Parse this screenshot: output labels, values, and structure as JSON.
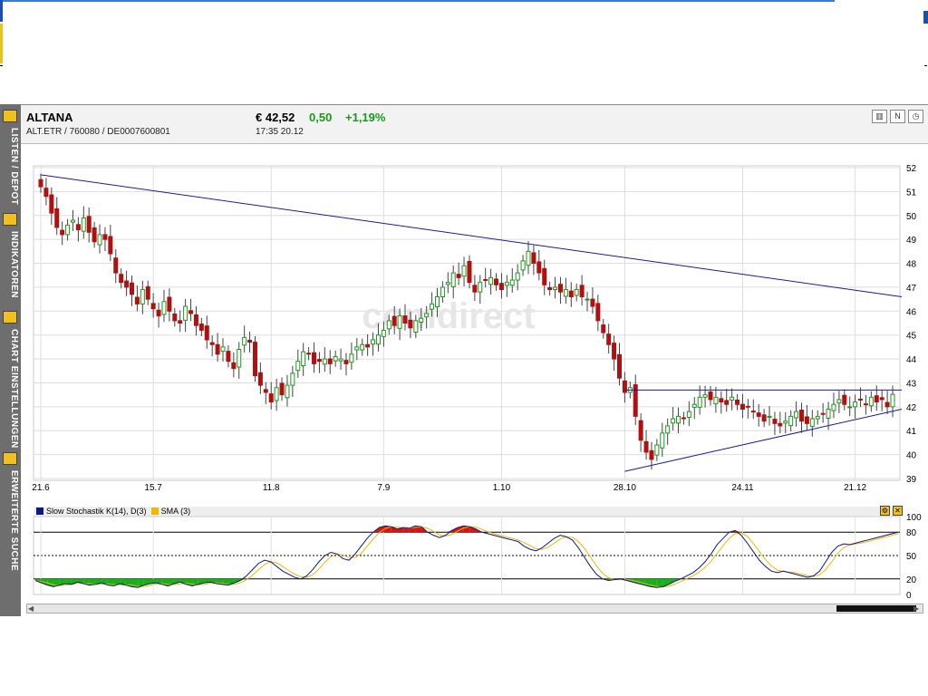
{
  "sidebar": {
    "items": [
      {
        "label": "LISTEN / DEPOT",
        "icon": "folder-icon"
      },
      {
        "label": "INDIKATOREN",
        "icon": "indicator-icon"
      },
      {
        "label": "CHART EINSTELLUNGEN",
        "icon": "settings-list-icon"
      },
      {
        "label": "ERWEITERTE SUCHE",
        "icon": "magnifier-icon"
      }
    ]
  },
  "header": {
    "name": "ALTANA",
    "codes": "ALT.ETR  /  760080  /  DE0007600801",
    "price": "€ 42,52",
    "change": "0,50",
    "change_pct": "+1,19%",
    "time": "17:35    20.12",
    "buttons": [
      "chart-type-icon",
      "news-icon",
      "clock-icon"
    ]
  },
  "watermark": "comdirect",
  "colors": {
    "up": "#1a9a1a",
    "down": "#b01010",
    "trendline": "#1a1aa0",
    "stoch_k": "#0a1a80",
    "stoch_d": "#f0b800",
    "fill_over": "#e01010",
    "fill_under": "#18b018"
  },
  "chart_data": [
    {
      "type": "candlestick",
      "title": "ALTANA",
      "x_tick_labels": [
        "21.6",
        "15.7",
        "11.8",
        "7.9",
        "1.10",
        "28.10",
        "24.11",
        "21.12"
      ],
      "y_ticks": [
        39,
        40,
        41,
        42,
        43,
        44,
        45,
        46,
        47,
        48,
        49,
        50,
        51,
        52
      ],
      "ylim": [
        39,
        52
      ],
      "grid": true,
      "close_series": [
        51.2,
        50.8,
        50.1,
        49.5,
        49.2,
        49.6,
        49.8,
        49.4,
        49.9,
        49.3,
        48.9,
        49.2,
        49.0,
        48.4,
        47.6,
        47.2,
        47.0,
        46.7,
        46.3,
        46.9,
        46.5,
        46.1,
        45.8,
        46.4,
        46.0,
        45.6,
        45.5,
        46.2,
        45.9,
        45.4,
        45.2,
        44.8,
        44.6,
        44.2,
        44.5,
        43.9,
        43.6,
        44.4,
        44.9,
        44.7,
        43.3,
        42.9,
        42.6,
        42.2,
        42.8,
        42.5,
        42.9,
        43.4,
        43.9,
        44.3,
        44.2,
        43.8,
        43.9,
        44.0,
        43.8,
        44.1,
        44.0,
        43.8,
        44.2,
        44.5,
        44.6,
        44.5,
        44.8,
        45.0,
        45.2,
        45.6,
        45.4,
        45.8,
        45.5,
        45.3,
        45.6,
        45.7,
        45.9,
        46.3,
        46.6,
        47.0,
        47.2,
        47.6,
        47.4,
        47.9,
        47.2,
        46.8,
        47.2,
        47.3,
        47.4,
        47.1,
        46.9,
        47.2,
        47.3,
        47.6,
        48.1,
        48.5,
        48.0,
        47.6,
        47.1,
        46.9,
        47.0,
        46.8,
        46.9,
        46.6,
        46.9,
        46.6,
        46.5,
        46.2,
        45.6,
        45.1,
        44.6,
        44.0,
        43.2,
        42.6,
        42.8,
        41.6,
        40.6,
        40.1,
        39.8,
        40.4,
        40.9,
        41.2,
        41.5,
        41.6,
        41.5,
        41.8,
        42.1,
        42.4,
        42.5,
        42.3,
        42.4,
        42.2,
        42.1,
        42.4,
        42.1,
        41.9,
        42.0,
        41.8,
        41.6,
        41.4,
        41.6,
        41.3,
        41.2,
        41.4,
        41.6,
        41.8,
        41.4,
        41.3,
        41.5,
        41.6,
        41.7,
        41.9,
        42.1,
        42.3,
        42.1,
        42.0,
        42.2,
        42.3,
        42.1,
        42.4,
        42.2,
        42.3,
        42.0,
        42.52
      ],
      "trendlines": [
        {
          "from": [
            "21.6",
            51.7
          ],
          "to": [
            "end",
            46.6
          ],
          "label": "resistance"
        },
        {
          "from": [
            "28.10",
            42.7
          ],
          "to": [
            "end",
            42.7
          ],
          "label": "horizontal"
        },
        {
          "from": [
            "28.10",
            39.3
          ],
          "to": [
            "end",
            41.9
          ],
          "label": "support"
        }
      ]
    },
    {
      "type": "line",
      "series": [
        {
          "name": "Slow Stochastik K(14), D(3)"
        },
        {
          "name": "SMA (3)"
        }
      ],
      "y_ticks": [
        0,
        20,
        50,
        80,
        100
      ],
      "ylim": [
        0,
        100
      ],
      "reference_lines": [
        20,
        50,
        80
      ],
      "k_values": [
        18,
        15,
        12,
        10,
        12,
        14,
        13,
        16,
        14,
        12,
        13,
        15,
        12,
        11,
        14,
        12,
        10,
        9,
        12,
        14,
        15,
        13,
        11,
        14,
        16,
        13,
        11,
        13,
        15,
        16,
        14,
        13,
        12,
        15,
        18,
        24,
        32,
        40,
        44,
        42,
        36,
        30,
        26,
        22,
        20,
        24,
        32,
        42,
        50,
        54,
        52,
        46,
        44,
        52,
        62,
        72,
        80,
        86,
        88,
        87,
        84,
        86,
        85,
        88,
        87,
        80,
        76,
        73,
        76,
        82,
        86,
        88,
        87,
        84,
        80,
        78,
        76,
        74,
        72,
        70,
        68,
        62,
        58,
        56,
        60,
        66,
        72,
        76,
        74,
        70,
        60,
        48,
        36,
        26,
        20,
        18,
        19,
        20,
        18,
        16,
        14,
        12,
        10,
        9,
        10,
        13,
        17,
        20,
        24,
        28,
        34,
        42,
        52,
        64,
        72,
        80,
        82,
        76,
        66,
        55,
        44,
        36,
        30,
        28,
        30,
        28,
        26,
        24,
        22,
        24,
        30,
        42,
        54,
        62,
        65,
        64,
        66,
        68,
        70,
        72,
        74,
        76,
        78,
        80
      ]
    }
  ],
  "indicator_legend": {
    "k_label": "Slow Stochastik K(14), D(3)",
    "d_label": "SMA (3)"
  },
  "scrollbar": {
    "thumb_position": 0.92
  }
}
